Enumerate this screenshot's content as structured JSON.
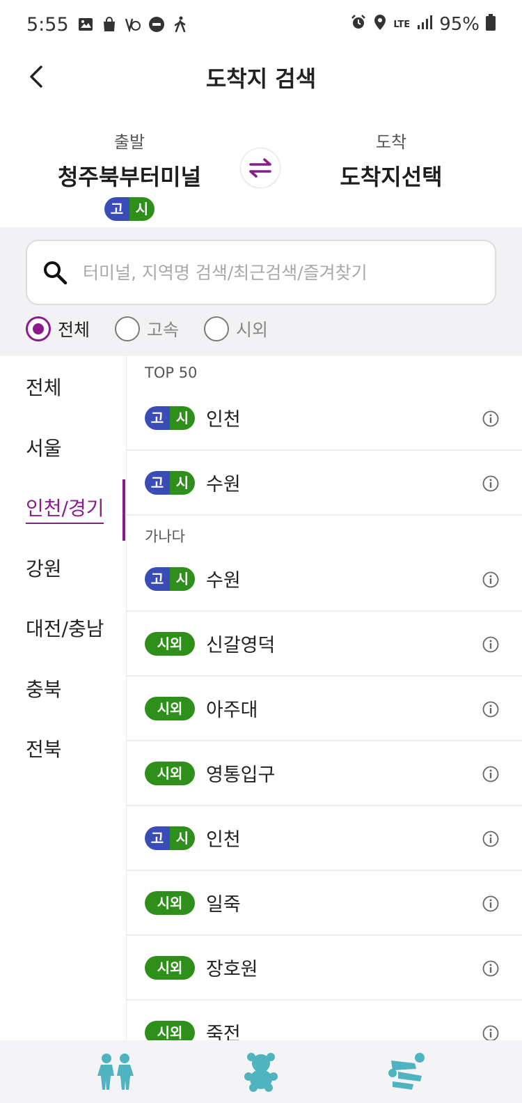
{
  "status": {
    "time": "5:55",
    "network": "LTE",
    "battery": "95%"
  },
  "header": {
    "title": "도착지 검색"
  },
  "route": {
    "departure_label": "출발",
    "departure_name": "청주북부터미널",
    "departure_badge": [
      "고",
      "시"
    ],
    "arrival_label": "도착",
    "arrival_name": "도착지선택"
  },
  "search": {
    "placeholder": "터미널, 지역명 검색/최근검색/즐겨찾기",
    "value": ""
  },
  "filters": [
    {
      "label": "전체",
      "selected": true
    },
    {
      "label": "고속",
      "selected": false
    },
    {
      "label": "시외",
      "selected": false
    }
  ],
  "sidebar": {
    "items": [
      {
        "label": "전체"
      },
      {
        "label": "서울"
      },
      {
        "label": "인천/경기",
        "active": true
      },
      {
        "label": "강원"
      },
      {
        "label": "대전/충남"
      },
      {
        "label": "충북"
      },
      {
        "label": "전북"
      }
    ]
  },
  "list": {
    "top_header": "TOP 50",
    "alpha_header": "가나다",
    "top": [
      {
        "badge": [
          "고",
          "시"
        ],
        "name": "인천"
      },
      {
        "badge": [
          "고",
          "시"
        ],
        "name": "수원"
      }
    ],
    "alpha": [
      {
        "badge": [
          "고",
          "시"
        ],
        "name": "수원"
      },
      {
        "badge": [
          "시외"
        ],
        "name": "신갈영덕"
      },
      {
        "badge": [
          "시외"
        ],
        "name": "아주대"
      },
      {
        "badge": [
          "시외"
        ],
        "name": "영통입구"
      },
      {
        "badge": [
          "고",
          "시"
        ],
        "name": "인천"
      },
      {
        "badge": [
          "시외"
        ],
        "name": "일죽"
      },
      {
        "badge": [
          "시외"
        ],
        "name": "장호원"
      },
      {
        "badge": [
          "시외"
        ],
        "name": "죽전"
      }
    ]
  },
  "colors": {
    "accent": "#8b1a8f",
    "express_blue": "#3a4cb5",
    "intercity_green": "#2e8f1a"
  },
  "bottom_nav": {
    "icons": [
      "people-figures-icon",
      "teddy-bear-icon",
      "lying-figures-icon"
    ]
  }
}
